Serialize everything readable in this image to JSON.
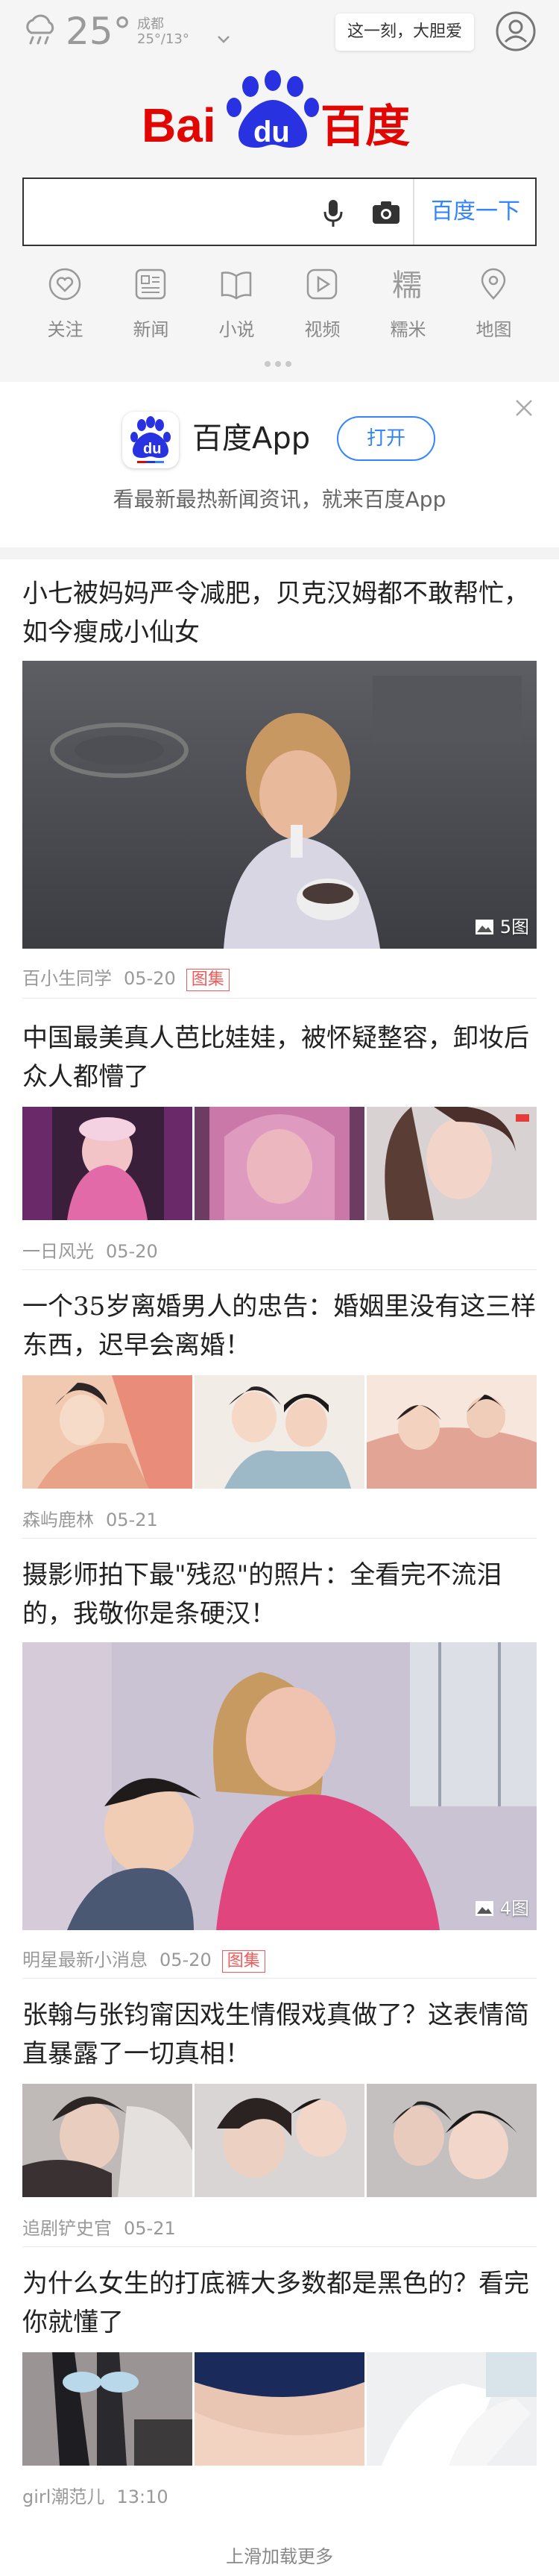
{
  "header": {
    "weather": {
      "icon": "rain-cloud-icon",
      "temperature": "25°",
      "city": "成都",
      "range": "25°/13°"
    },
    "slogan": "这一刻，大胆爱",
    "logo_text": "Bai du 百度",
    "brand_colors": {
      "red": "#e10601",
      "blue": "#2932e1",
      "accent": "#3385ff"
    }
  },
  "search": {
    "value": "",
    "placeholder": "",
    "button_label": "百度一下"
  },
  "nav": [
    {
      "icon": "heart-icon",
      "label": "关注"
    },
    {
      "icon": "news-icon",
      "label": "新闻"
    },
    {
      "icon": "book-icon",
      "label": "小说"
    },
    {
      "icon": "play-icon",
      "label": "视频"
    },
    {
      "icon": "nuomi-icon",
      "label": "糯米"
    },
    {
      "icon": "map-pin-icon",
      "label": "地图"
    }
  ],
  "app_banner": {
    "name": "百度App",
    "open_label": "打开",
    "description": "看最新最热新闻资讯，就来百度App"
  },
  "feed": [
    {
      "title": "小七被妈妈严令减肥，贝克汉姆都不敢帮忙，如今瘦成小仙女",
      "source": "百小生同学",
      "date": "05-20",
      "tag": "图集",
      "image_count": "5图"
    },
    {
      "title": "中国最美真人芭比娃娃，被怀疑整容，卸妆后众人都懵了",
      "source": "一日风光",
      "date": "05-20"
    },
    {
      "title": "一个35岁离婚男人的忠告：婚姻里没有这三样东西，迟早会离婚！",
      "source": "森屿鹿林",
      "date": "05-21"
    },
    {
      "title": "摄影师拍下最\"残忍\"的照片：全看完不流泪的，我敬你是条硬汉！",
      "source": "明星最新小消息",
      "date": "05-20",
      "tag": "图集",
      "image_count": "4图"
    },
    {
      "title": "张翰与张钧甯因戏生情假戏真做了？这表情简直暴露了一切真相！",
      "source": "追剧铲史官",
      "date": "05-21"
    },
    {
      "title": "为什么女生的打底裤大多数都是黑色的？看完你就懂了",
      "source": "girl潮范儿",
      "date": "13:10"
    }
  ],
  "load_more": "上滑加载更多"
}
